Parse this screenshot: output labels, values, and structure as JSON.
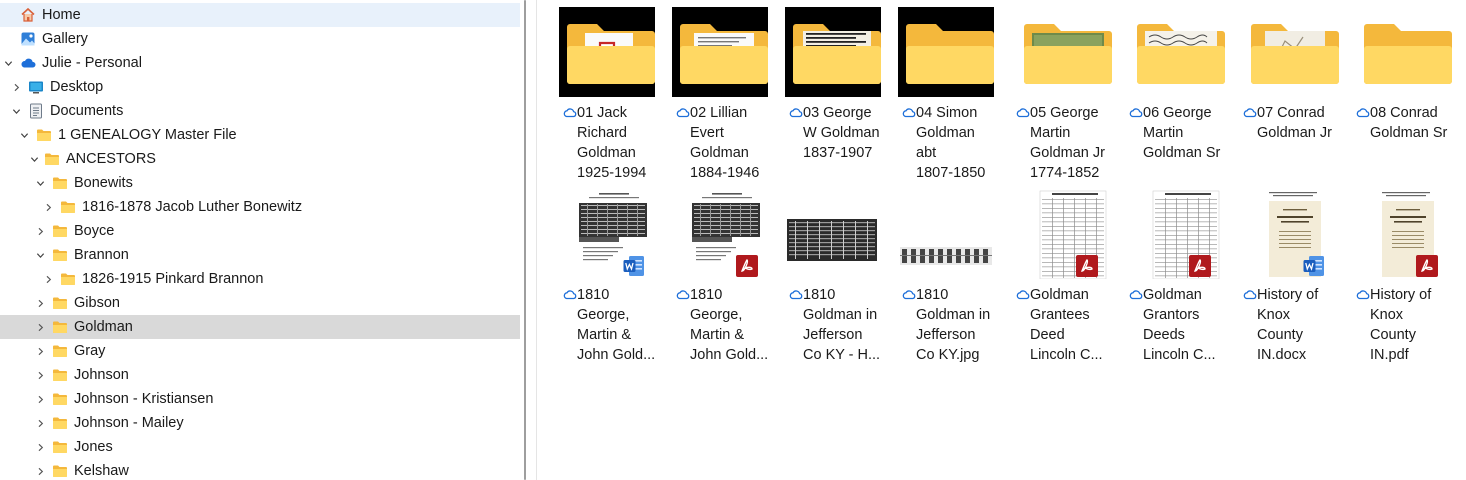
{
  "nav": {
    "items": [
      {
        "label": "Home",
        "icon": "home-icon",
        "level": 0,
        "chevron": "none"
      },
      {
        "label": "Gallery",
        "icon": "gallery-icon",
        "level": 0,
        "chevron": "none"
      },
      {
        "label": "Julie - Personal",
        "icon": "onedrive-cloud-icon",
        "level": 0,
        "chevron": "down"
      },
      {
        "label": "Desktop",
        "icon": "desktop-icon",
        "level": 1,
        "chevron": "right"
      },
      {
        "label": "Documents",
        "icon": "documents-icon",
        "level": 1,
        "chevron": "down"
      },
      {
        "label": "1 GENEALOGY Master File",
        "icon": "folder-icon",
        "level": 2,
        "chevron": "down"
      },
      {
        "label": "ANCESTORS",
        "icon": "folder-icon",
        "level": 3,
        "chevron": "down"
      },
      {
        "label": "Bonewits",
        "icon": "folder-icon",
        "level": 4,
        "chevron": "down"
      },
      {
        "label": "1816-1878 Jacob Luther Bonewitz",
        "icon": "folder-icon",
        "level": 5,
        "chevron": "right"
      },
      {
        "label": "Boyce",
        "icon": "folder-icon",
        "level": 4,
        "chevron": "right"
      },
      {
        "label": "Brannon",
        "icon": "folder-icon",
        "level": 4,
        "chevron": "down"
      },
      {
        "label": "1826-1915 Pinkard Brannon",
        "icon": "folder-icon",
        "level": 5,
        "chevron": "right"
      },
      {
        "label": "Gibson",
        "icon": "folder-icon",
        "level": 4,
        "chevron": "right"
      },
      {
        "label": "Goldman",
        "icon": "folder-icon",
        "level": 4,
        "chevron": "right",
        "selected": true
      },
      {
        "label": "Gray",
        "icon": "folder-icon",
        "level": 4,
        "chevron": "right"
      },
      {
        "label": "Johnson",
        "icon": "folder-icon",
        "level": 4,
        "chevron": "right"
      },
      {
        "label": "Johnson - Kristiansen",
        "icon": "folder-icon",
        "level": 4,
        "chevron": "right"
      },
      {
        "label": "Johnson - Mailey",
        "icon": "folder-icon",
        "level": 4,
        "chevron": "right"
      },
      {
        "label": "Jones",
        "icon": "folder-icon",
        "level": 4,
        "chevron": "right"
      },
      {
        "label": "Kelshaw",
        "icon": "folder-icon",
        "level": 4,
        "chevron": "right"
      }
    ]
  },
  "content": {
    "tiles": [
      {
        "name": "01 Jack Richard Goldman 1925-1994",
        "lines": [
          "01 Jack",
          "Richard",
          "Goldman",
          "1925-1994"
        ],
        "kind": "folder",
        "preview": "pdf",
        "dark_bg": true,
        "status_icon": "cloud-sync-icon"
      },
      {
        "name": "02 Lillian Evert Goldman 1884-1946",
        "lines": [
          "02 Lillian",
          "Evert",
          "Goldman",
          "1884-1946"
        ],
        "kind": "folder",
        "preview": "doc",
        "dark_bg": true,
        "status_icon": "cloud-sync-icon"
      },
      {
        "name": "03 George W Goldman 1837-1907",
        "lines": [
          "03 George",
          "W Goldman",
          "1837-1907"
        ],
        "kind": "folder",
        "preview": "news",
        "dark_bg": true,
        "status_icon": "cloud-sync-icon"
      },
      {
        "name": "04 Simon Goldman abt 1807-1850",
        "lines": [
          "04 Simon",
          "Goldman",
          "abt",
          "1807-1850"
        ],
        "kind": "folder",
        "preview": "none",
        "dark_bg": true,
        "status_icon": "cloud-sync-icon"
      },
      {
        "name": "05 George Martin Goldman Jr 1774-1852",
        "lines": [
          "05 George",
          "Martin",
          "Goldman Jr",
          "1774-1852"
        ],
        "kind": "folder",
        "preview": "grave",
        "dark_bg": false,
        "status_icon": "cloud-sync-icon"
      },
      {
        "name": "06 George Martin Goldman Sr",
        "lines": [
          "06 George",
          "Martin",
          "Goldman Sr"
        ],
        "kind": "folder",
        "preview": "script",
        "dark_bg": false,
        "status_icon": "cloud-sync-icon"
      },
      {
        "name": "07 Conrad Goldman Jr",
        "lines": [
          "07 Conrad",
          "Goldman Jr"
        ],
        "kind": "folder",
        "preview": "sketch",
        "dark_bg": false,
        "status_icon": "cloud-sync-icon"
      },
      {
        "name": "08 Conrad Goldman Sr",
        "lines": [
          "08 Conrad",
          "Goldman Sr"
        ],
        "kind": "folder",
        "preview": "none",
        "dark_bg": false,
        "status_icon": "cloud-sync-icon"
      },
      {
        "name": "1810 George, Martin & John Goldman.docx",
        "lines": [
          "1810",
          "George,",
          "Martin &",
          "John Gold..."
        ],
        "kind": "file",
        "preview": "census",
        "badge": "word-badge-icon",
        "status_icon": "cloud-sync-icon"
      },
      {
        "name": "1810 George, Martin & John Goldman.pdf",
        "lines": [
          "1810",
          "George,",
          "Martin &",
          "John Gold..."
        ],
        "kind": "file",
        "preview": "census",
        "badge": "pdf-badge-icon",
        "status_icon": "cloud-sync-icon"
      },
      {
        "name": "1810 Goldman in Jefferson Co KY - H...",
        "lines": [
          "1810",
          "Goldman in",
          "Jefferson",
          "Co KY - H..."
        ],
        "kind": "file",
        "preview": "scan-dark",
        "badge": "none",
        "status_icon": "cloud-sync-icon"
      },
      {
        "name": "1810 Goldman in Jefferson Co KY.jpg",
        "lines": [
          "1810",
          "Goldman in",
          "Jefferson",
          "Co KY.jpg"
        ],
        "kind": "file",
        "preview": "scan-strip",
        "badge": "none",
        "status_icon": "cloud-sync-icon"
      },
      {
        "name": "Goldman Grantees Deed Lincoln C...",
        "lines": [
          "Goldman",
          "Grantees",
          "Deed",
          "Lincoln C..."
        ],
        "kind": "file",
        "preview": "ledger",
        "badge": "pdf-badge-icon",
        "status_icon": "cloud-sync-icon"
      },
      {
        "name": "Goldman Grantors Deeds Lincoln C...",
        "lines": [
          "Goldman",
          "Grantors",
          "Deeds",
          "Lincoln C..."
        ],
        "kind": "file",
        "preview": "ledger",
        "badge": "pdf-badge-icon",
        "status_icon": "cloud-sync-icon"
      },
      {
        "name": "History of Knox County IN.docx",
        "lines": [
          "History of",
          "Knox",
          "County",
          "IN.docx"
        ],
        "kind": "file",
        "preview": "book",
        "badge": "word-badge-icon",
        "status_icon": "cloud-sync-icon"
      },
      {
        "name": "History of Knox County IN.pdf",
        "lines": [
          "History of",
          "Knox",
          "County",
          "IN.pdf"
        ],
        "kind": "file",
        "preview": "book",
        "badge": "pdf-badge-icon",
        "status_icon": "cloud-sync-icon"
      }
    ]
  },
  "colors": {
    "folder_back": "#f4b83c",
    "folder_front": "#ffd863",
    "selected_row": "#d9d9d9",
    "home_row": "#e8f1fb",
    "onedrive_blue": "#1e6fd9",
    "pdf_red": "#b0191d",
    "word_blue": "#1b5ebe"
  }
}
